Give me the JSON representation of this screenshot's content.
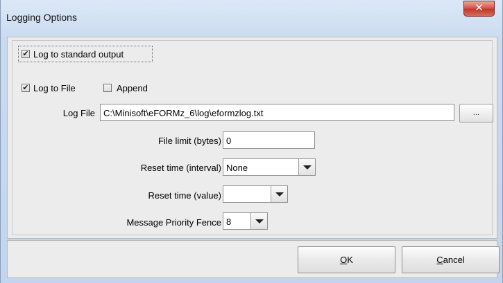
{
  "window": {
    "title": "Logging Options",
    "close_glyph": "✕"
  },
  "options": {
    "log_stdout": {
      "label": "Log to standard output",
      "checked": true
    },
    "log_file": {
      "label": "Log to File",
      "checked": true
    },
    "append": {
      "label": "Append",
      "checked": false
    }
  },
  "fields": {
    "log_file": {
      "label": "Log File",
      "value": "C:\\Minisoft\\eFORMz_6\\log\\eformzlog.txt",
      "browse_label": "..."
    },
    "file_limit": {
      "label": "File limit (bytes)",
      "value": "0"
    },
    "reset_interval": {
      "label": "Reset time (interval)",
      "value": "None"
    },
    "reset_value": {
      "label": "Reset time (value)",
      "value": ""
    },
    "priority_fence": {
      "label": "Message Priority Fence",
      "value": "8"
    }
  },
  "buttons": {
    "ok": "OK",
    "cancel": "Cancel",
    "ok_mnemonic": "O",
    "ok_rest": "K",
    "cancel_mnemonic": "C",
    "cancel_rest": "ancel"
  },
  "icons": {
    "check": "checkmark-icon",
    "dropdown": "chevron-down-icon",
    "close": "close-icon"
  }
}
